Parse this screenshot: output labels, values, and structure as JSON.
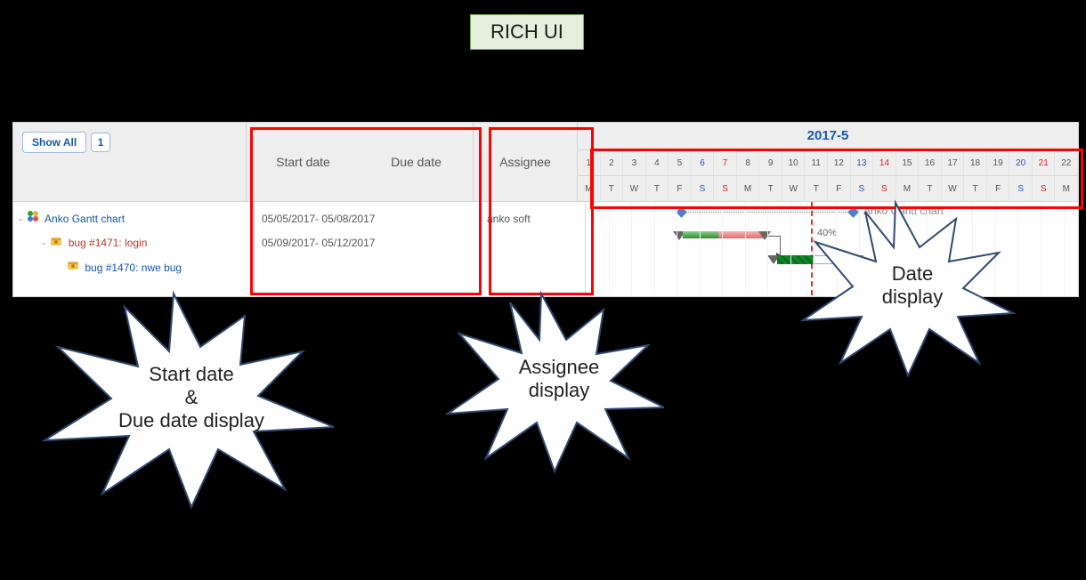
{
  "badge": "RICH UI",
  "sidebar": {
    "show_all_label": "Show All",
    "page_label": "1",
    "columns": {
      "start": "Start date",
      "due": "Due date",
      "assignee": "Assignee"
    }
  },
  "calendar": {
    "month": "2017-5",
    "days": [
      {
        "n": "1",
        "d": "M",
        "w": false
      },
      {
        "n": "2",
        "d": "T",
        "w": false
      },
      {
        "n": "3",
        "d": "W",
        "w": false
      },
      {
        "n": "4",
        "d": "T",
        "w": false
      },
      {
        "n": "5",
        "d": "F",
        "w": false
      },
      {
        "n": "6",
        "d": "S",
        "w": "sat"
      },
      {
        "n": "7",
        "d": "S",
        "w": "sun"
      },
      {
        "n": "8",
        "d": "M",
        "w": false
      },
      {
        "n": "9",
        "d": "T",
        "w": false
      },
      {
        "n": "10",
        "d": "W",
        "w": false
      },
      {
        "n": "11",
        "d": "T",
        "w": false
      },
      {
        "n": "12",
        "d": "F",
        "w": false
      },
      {
        "n": "13",
        "d": "S",
        "w": "sat"
      },
      {
        "n": "14",
        "d": "S",
        "w": "sun"
      },
      {
        "n": "15",
        "d": "M",
        "w": false
      },
      {
        "n": "16",
        "d": "T",
        "w": false
      },
      {
        "n": "17",
        "d": "W",
        "w": false
      },
      {
        "n": "18",
        "d": "T",
        "w": false
      },
      {
        "n": "19",
        "d": "F",
        "w": false
      },
      {
        "n": "20",
        "d": "S",
        "w": "sat"
      },
      {
        "n": "21",
        "d": "S",
        "w": "sun"
      },
      {
        "n": "22",
        "d": "M",
        "w": false
      }
    ]
  },
  "rows": [
    {
      "kind": "project",
      "label": "Anko Gantt chart",
      "dates": "",
      "assignee": ""
    },
    {
      "kind": "bug",
      "label": "bug #1471: login",
      "dates": "05/05/2017- 05/08/2017",
      "assignee": ""
    },
    {
      "kind": "bug2",
      "label": "bug #1470: nwe bug",
      "dates": "05/09/2017- 05/12/2017",
      "assignee": "anko soft"
    }
  ],
  "gantt": {
    "milestone_label": "Anko Gantt chart",
    "pct_label": "40%"
  },
  "callouts": {
    "dates": "Start date\n&\nDue date display",
    "assignee": "Assignee\ndisplay",
    "datehdr": "Date\ndisplay"
  }
}
